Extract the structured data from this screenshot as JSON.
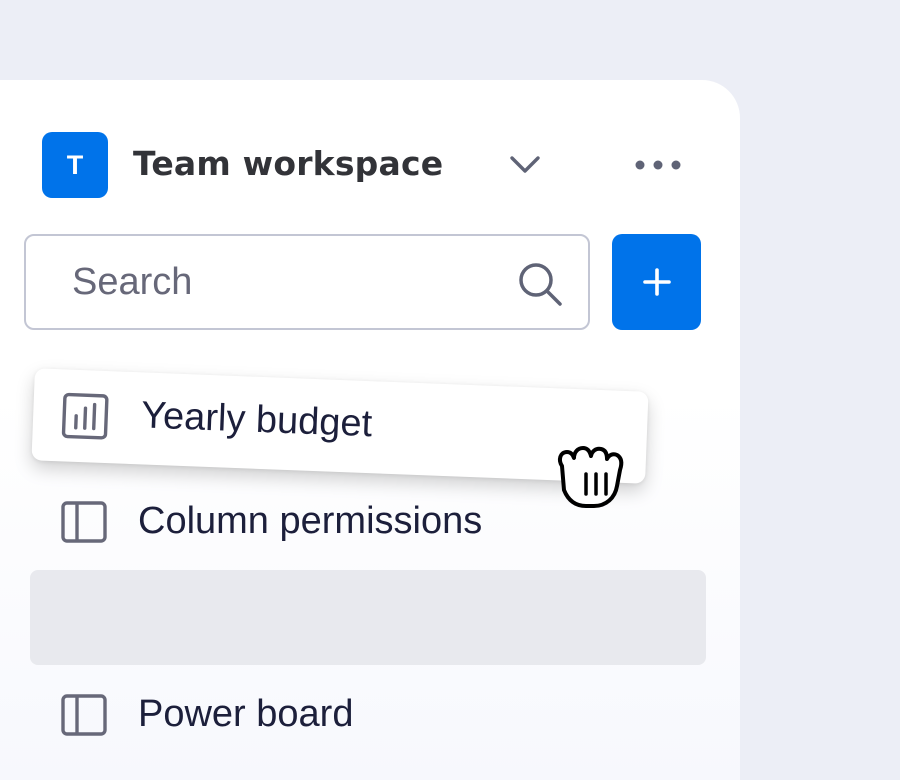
{
  "workspace": {
    "avatar_letter": "T",
    "name": "Team workspace",
    "chevron_icon": "chevron-down-icon",
    "more_icon": "more-horizontal-icon",
    "accent_color": "#0073ea"
  },
  "search": {
    "placeholder": "Search",
    "value": "",
    "icon": "search-icon"
  },
  "add_button": {
    "label": "+",
    "icon": "plus-icon"
  },
  "dragging_item": {
    "label": "Yearly budget",
    "icon": "dashboard-icon"
  },
  "items": [
    {
      "label": "Column permissions",
      "icon": "board-icon"
    },
    {
      "label": "Power board",
      "icon": "board-icon"
    }
  ],
  "cursor": {
    "icon": "grab-hand-icon"
  }
}
